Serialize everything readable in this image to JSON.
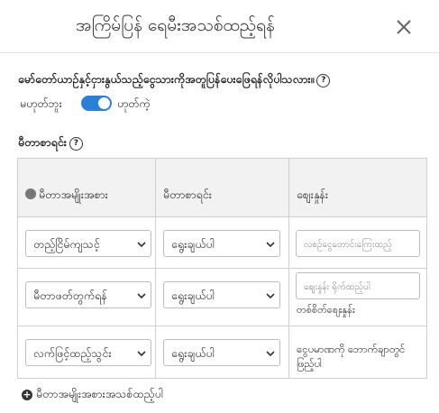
{
  "modal": {
    "title": "အကြိမ်ပြန် ရေမီးအသစ်ထည့်ရန်",
    "close_symbol": "×"
  },
  "question": {
    "text": "မော်တော်ယာဉ်နှင့်ငှားနွယ်သည့်ငွေသားကိုအတူပြန်ပေးဖြေရန်လိုပါသလား။",
    "help_symbol": "?"
  },
  "toggle": {
    "off_label": "မဟုတ်ဘူး",
    "on_label": "ဟုတ်ကဲ့",
    "state": "on",
    "accent_color": "#2a7fd6"
  },
  "meter_section": {
    "label": "မီတာစာရင်း",
    "help_symbol": "?"
  },
  "table": {
    "headers": [
      "မီတာအမျိုးအစား",
      "မီတာစာရင်း",
      "စျေးနှုန်း"
    ],
    "rows": [
      {
        "type": "တည့်ငြိမ်ကျသင့်",
        "meter": "ရွေးချယ်ပါ",
        "price_placeholder": "လစဉ်ငွေတောင်းကြေးထည့်",
        "price_note": ""
      },
      {
        "type": "မီတာဖတ်တွက်ရန်",
        "meter": "ရွေးချယ်ပါ",
        "price_placeholder": "စျေးနှုန်း ရိုက်ထည့်ပါ",
        "price_note": "တစ်စိတ်စျေးနှုန်း"
      },
      {
        "type": "လက်ဖြင့်ထည့်သွင်း",
        "meter": "ရွေးချယ်ပါ",
        "price_text": "ငွေပမာဏကို ဘောက်ချာတွင် ဖြည့်ပါ"
      }
    ]
  },
  "add_button": {
    "label": "မီတာအမျိုးအစားအသစ်ထည့်ပါ"
  },
  "icons": [
    "close-icon",
    "help-icon",
    "gear-icon",
    "chevron-down-icon",
    "plus-circle-icon"
  ]
}
